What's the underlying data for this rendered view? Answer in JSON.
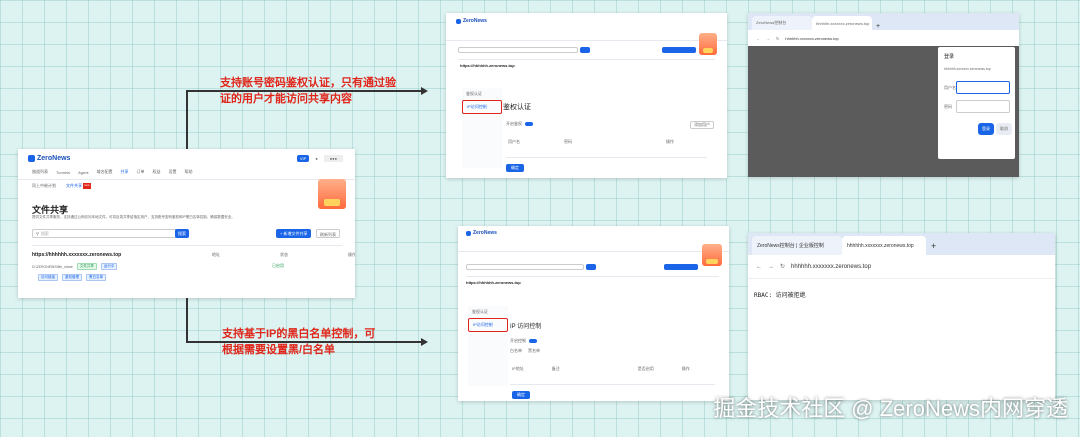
{
  "main": {
    "logo": "ZeroNews",
    "nav": [
      "隧道列表",
      "Tunnels",
      "Agent",
      "域名配置",
      "共享",
      "订单",
      "权益",
      "设置",
      "帮助"
    ],
    "subtabs": [
      "同上中继计划",
      "文件共享"
    ],
    "subtab_badge": "new",
    "page_title": "文件共享",
    "description": "提供文件共享服务，支持通过公网访问本地文件。可将目录共享给指定用户，支持账号密码鉴权和IP黑白名单控制，确保数据安全。",
    "search_placeholder": "搜索",
    "search_button": "搜索",
    "add_button": "+ 新增文件共享",
    "refresh_button": "刷新列表",
    "row_url": "https://hhhhhh.xxxxxxx.zeronews.top",
    "row_path": "D:\\ZERONEWS\\file_share",
    "row_tags": [
      "文件共享",
      "运行中"
    ],
    "row_status": "已启用",
    "row_actions": [
      "访问链接",
      "鉴权管理",
      "黑白名单"
    ],
    "col_headers": [
      "地址",
      "状态",
      "操作"
    ]
  },
  "captions": {
    "top": "支持账号密码鉴权认证，只有通过验证的用户才能访问共享内容",
    "bottom": "支持基于IP的黑白名单控制，可根据需要设置黑/白名单"
  },
  "auth_panel": {
    "logo": "ZeroNews",
    "menu": [
      "鉴权认证",
      "IP访问控制"
    ],
    "title": "鉴权认证",
    "toggle_label": "开启鉴权",
    "add_button": "添加用户",
    "table_headers": [
      "用户名",
      "密码",
      "操作"
    ],
    "confirm": "确定"
  },
  "ip_panel": {
    "logo": "ZeroNews",
    "menu": [
      "鉴权认证",
      "IP访问控制"
    ],
    "title": "IP 访问控制",
    "toggle_label": "开启控制",
    "mode_options": [
      "白名单",
      "黑名单"
    ],
    "table_headers": [
      "IP地址",
      "备注",
      "是否启用",
      "操作"
    ],
    "confirm": "确定"
  },
  "login_browser": {
    "tab1": "ZeroNews控制台",
    "tab2": "hhhhhh.xxxxxxx.zeronews.top",
    "address": "hhhhhh.xxxxxxx.zeronews.top",
    "dialog_title": "登录",
    "dialog_subtitle": "hhhhhh.xxxxxxx.zeronews.top",
    "username_label": "用户名",
    "password_label": "密码",
    "login_button": "登录",
    "cancel_button": "取消"
  },
  "rbac_browser": {
    "tab1": "ZeroNews控制台 | 企业版控制",
    "tab2": "hhhhhh.xxxxxxx.zeronews.top",
    "address": "hhhhhh.xxxxxxx.zeronews.top",
    "body_text": "RBAC: 访问被拒绝"
  },
  "watermark": "掘金技术社区 @ ZeroNews内网穿透",
  "colors": {
    "caption": "#e0261b",
    "accent": "#1a64e8",
    "background": "#dcf3f1"
  }
}
